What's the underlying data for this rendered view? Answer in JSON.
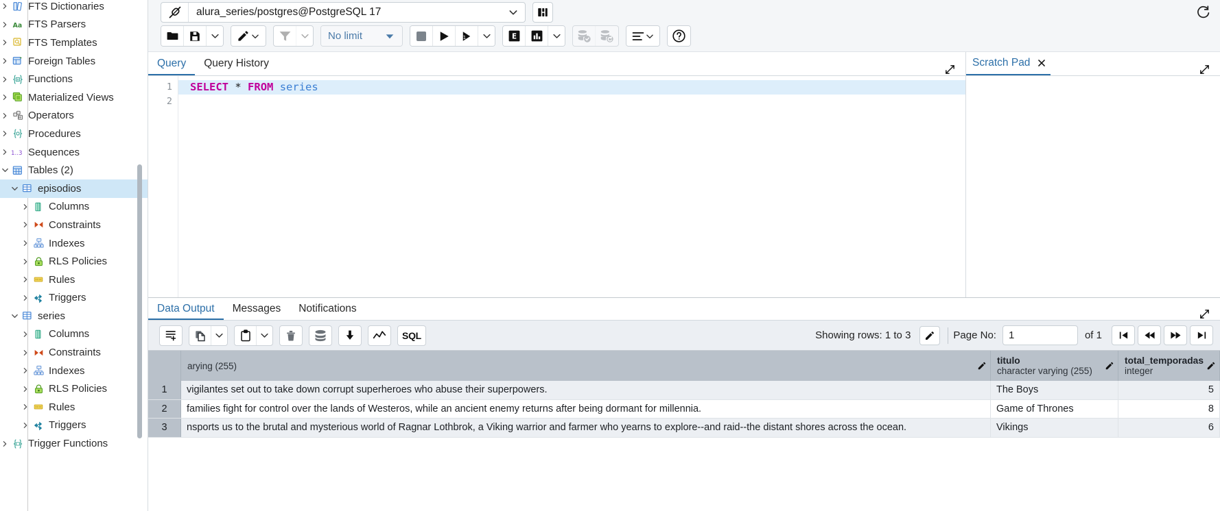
{
  "sidebar": {
    "items": [
      {
        "label": "FTS Dictionaries",
        "icon": "fts-dictionaries-icon",
        "indent": 1,
        "twisty": ">",
        "selected": false
      },
      {
        "label": "FTS Parsers",
        "icon": "fts-parsers-icon",
        "indent": 1,
        "twisty": ">",
        "selected": false
      },
      {
        "label": "FTS Templates",
        "icon": "fts-templates-icon",
        "indent": 1,
        "twisty": ">",
        "selected": false
      },
      {
        "label": "Foreign Tables",
        "icon": "foreign-tables-icon",
        "indent": 1,
        "twisty": ">",
        "selected": false
      },
      {
        "label": "Functions",
        "icon": "functions-icon",
        "indent": 1,
        "twisty": ">",
        "selected": false
      },
      {
        "label": "Materialized Views",
        "icon": "materialized-views-icon",
        "indent": 1,
        "twisty": ">",
        "selected": false
      },
      {
        "label": "Operators",
        "icon": "operators-icon",
        "indent": 1,
        "twisty": ">",
        "selected": false
      },
      {
        "label": "Procedures",
        "icon": "procedures-icon",
        "indent": 1,
        "twisty": ">",
        "selected": false
      },
      {
        "label": "Sequences",
        "icon": "sequences-icon",
        "indent": 1,
        "twisty": ">",
        "selected": false
      },
      {
        "label": "Tables (2)",
        "icon": "tables-icon",
        "indent": 1,
        "twisty": "v",
        "selected": false
      },
      {
        "label": "episodios",
        "icon": "table-icon",
        "indent": 2,
        "twisty": "v",
        "selected": true
      },
      {
        "label": "Columns",
        "icon": "columns-icon",
        "indent": 3,
        "twisty": ">",
        "selected": false
      },
      {
        "label": "Constraints",
        "icon": "constraints-icon",
        "indent": 3,
        "twisty": ">",
        "selected": false
      },
      {
        "label": "Indexes",
        "icon": "indexes-icon",
        "indent": 3,
        "twisty": ">",
        "selected": false
      },
      {
        "label": "RLS Policies",
        "icon": "rls-policies-icon",
        "indent": 3,
        "twisty": ">",
        "selected": false
      },
      {
        "label": "Rules",
        "icon": "rules-icon",
        "indent": 3,
        "twisty": ">",
        "selected": false
      },
      {
        "label": "Triggers",
        "icon": "triggers-icon",
        "indent": 3,
        "twisty": ">",
        "selected": false
      },
      {
        "label": "series",
        "icon": "table-icon",
        "indent": 2,
        "twisty": "v",
        "selected": false
      },
      {
        "label": "Columns",
        "icon": "columns-icon",
        "indent": 3,
        "twisty": ">",
        "selected": false
      },
      {
        "label": "Constraints",
        "icon": "constraints-icon",
        "indent": 3,
        "twisty": ">",
        "selected": false
      },
      {
        "label": "Indexes",
        "icon": "indexes-icon",
        "indent": 3,
        "twisty": ">",
        "selected": false
      },
      {
        "label": "RLS Policies",
        "icon": "rls-policies-icon",
        "indent": 3,
        "twisty": ">",
        "selected": false
      },
      {
        "label": "Rules",
        "icon": "rules-icon",
        "indent": 3,
        "twisty": ">",
        "selected": false
      },
      {
        "label": "Triggers",
        "icon": "triggers-icon",
        "indent": 3,
        "twisty": ">",
        "selected": false
      },
      {
        "label": "Trigger Functions",
        "icon": "trigger-functions-icon",
        "indent": 1,
        "twisty": ">",
        "selected": false
      }
    ]
  },
  "connection": {
    "value": "alura_series/postgres@PostgreSQL 17",
    "icon": "connection-icon",
    "caret": "chevron-down-icon",
    "manage_icon": "manage-connections-icon",
    "reset_icon": "reset-layout-icon"
  },
  "toolbar": {
    "open_file": "open-file-icon",
    "save_file": "save-file-icon",
    "save_caret": "chevron-down-icon",
    "edit": "edit-pencil-icon",
    "edit_caret": "chevron-down-icon",
    "filter": "filter-icon",
    "filter_caret": "chevron-down-icon",
    "limit_label": "No limit",
    "limit_caret": "chevron-down-icon",
    "stop": "stop-icon",
    "execute": "execute-play-icon",
    "execute_step": "execute-to-cursor-icon",
    "execute_caret": "chevron-down-icon",
    "explain": "explain-icon",
    "explain_analyze": "explain-analyze-icon",
    "explain_caret": "chevron-down-icon",
    "commit": "commit-icon",
    "rollback": "rollback-icon",
    "macros": "macros-icon",
    "macros_caret": "chevron-down-icon",
    "help": "help-icon"
  },
  "editor": {
    "tabs": [
      {
        "label": "Query",
        "active": true
      },
      {
        "label": "Query History",
        "active": false
      }
    ],
    "expand_icon": "expand-icon",
    "lines": [
      "1",
      "2"
    ],
    "sql": {
      "keyword1": "SELECT",
      "star": "*",
      "keyword2": "FROM",
      "identifier": "series"
    }
  },
  "scratch_pad": {
    "title": "Scratch Pad",
    "close_icon": "close-icon",
    "expand_icon": "expand-icon"
  },
  "results": {
    "tabs": [
      {
        "label": "Data Output",
        "active": true
      },
      {
        "label": "Messages",
        "active": false
      },
      {
        "label": "Notifications",
        "active": false
      }
    ],
    "expand_icon": "expand-icon",
    "toolbar": {
      "add_row": "add-row-icon",
      "copy": "copy-icon",
      "copy_caret": "chevron-down-icon",
      "paste": "paste-icon",
      "paste_caret": "chevron-down-icon",
      "delete": "delete-row-icon",
      "save_data": "save-data-changes-icon",
      "download": "download-csv-icon",
      "graph": "graph-visualiser-icon",
      "sql": "SQL"
    },
    "showing_rows": "Showing rows: 1 to 3",
    "edit_icon": "pencil-icon",
    "page_no_label": "Page No:",
    "page_no_value": "1",
    "of_label": "of 1",
    "nav": {
      "first": "first-page-icon",
      "prev": "previous-page-icon",
      "next": "next-page-icon",
      "last": "last-page-icon"
    },
    "columns": [
      {
        "name": "",
        "type": "arying (255)",
        "kind": "desc",
        "pen": "pencil-icon"
      },
      {
        "name": "titulo",
        "type": "character varying (255)",
        "kind": "titulo",
        "pen": "pencil-icon"
      },
      {
        "name": "total_temporadas",
        "type": "integer",
        "kind": "temp",
        "pen": "pencil-icon"
      }
    ],
    "rows": [
      {
        "n": "1",
        "desc": "vigilantes set out to take down corrupt superheroes who abuse their superpowers.",
        "titulo": "The Boys",
        "total_temporadas": "5"
      },
      {
        "n": "2",
        "desc": " families fight for control over the lands of Westeros, while an ancient enemy returns after being dormant for millennia.",
        "titulo": "Game of Thrones",
        "total_temporadas": "8"
      },
      {
        "n": "3",
        "desc": "nsports us to the brutal and mysterious world of Ragnar Lothbrok, a Viking warrior and farmer who yearns to explore--and raid--the distant shores across the ocean.",
        "titulo": "Vikings",
        "total_temporadas": "6"
      }
    ]
  },
  "colors": {
    "accent": "#2c6fa8",
    "header_bg": "#b9c1ca",
    "selection": "#cfe7f7",
    "keyword": "#c0009a",
    "identifier": "#3b7fd4"
  }
}
